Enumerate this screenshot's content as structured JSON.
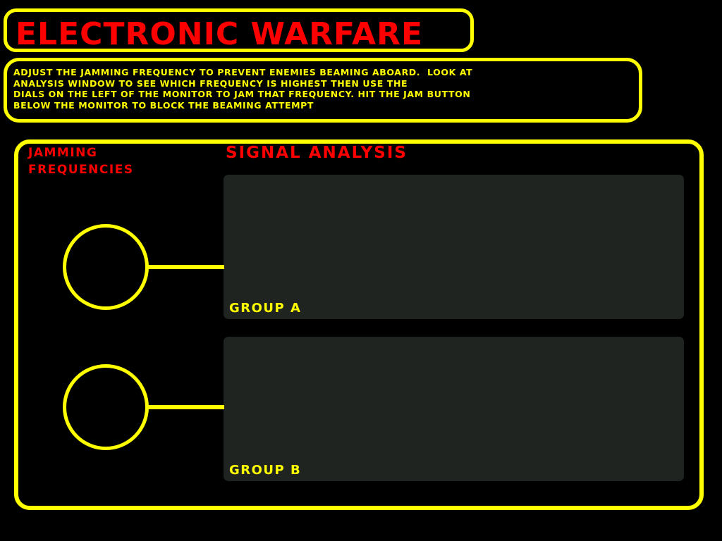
{
  "header": {
    "title": "ELECTRONIC WARFARE"
  },
  "instructions": {
    "lines": [
      "ADJUST THE JAMMING FREQUENCY TO PREVENT ENEMIES BEAMING ABOARD.  LOOK AT",
      "ANALYSIS WINDOW TO SEE WHICH FREQUENCY IS HIGHEST THEN USE THE",
      "DIALS ON THE LEFT OF THE MONITOR TO JAM THAT FREQUENCY. HIT THE JAM BUTTON",
      "BELOW THE MONITOR TO BLOCK THE BEAMING ATTEMPT"
    ]
  },
  "jamming": {
    "heading_line1": "JAMMING",
    "heading_line2": "FREQUENCIES"
  },
  "analysis": {
    "heading": "SIGNAL ANALYSIS",
    "groups": [
      {
        "label": "GROUP A"
      },
      {
        "label": "GROUP B"
      }
    ]
  },
  "colors": {
    "background": "#000000",
    "frame": "#ffff00",
    "heading": "#ff0000",
    "monitor": "#202420"
  },
  "icons": {
    "dial_a": "dial-icon",
    "dial_b": "dial-icon"
  }
}
